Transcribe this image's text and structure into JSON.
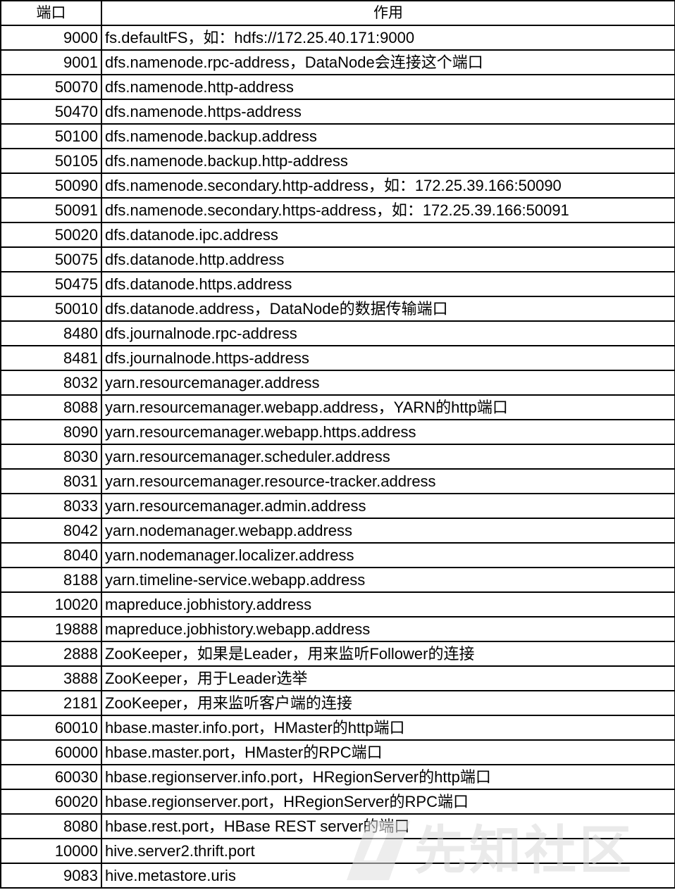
{
  "headers": {
    "port": "端口",
    "use": "作用"
  },
  "rows": [
    {
      "port": "9000",
      "use": "fs.defaultFS，如：hdfs://172.25.40.171:9000"
    },
    {
      "port": "9001",
      "use": "dfs.namenode.rpc-address，DataNode会连接这个端口"
    },
    {
      "port": "50070",
      "use": "dfs.namenode.http-address"
    },
    {
      "port": "50470",
      "use": "dfs.namenode.https-address"
    },
    {
      "port": "50100",
      "use": "dfs.namenode.backup.address"
    },
    {
      "port": "50105",
      "use": "dfs.namenode.backup.http-address"
    },
    {
      "port": "50090",
      "use": "dfs.namenode.secondary.http-address，如：172.25.39.166:50090"
    },
    {
      "port": "50091",
      "use": "dfs.namenode.secondary.https-address，如：172.25.39.166:50091"
    },
    {
      "port": "50020",
      "use": "dfs.datanode.ipc.address"
    },
    {
      "port": "50075",
      "use": "dfs.datanode.http.address"
    },
    {
      "port": "50475",
      "use": "dfs.datanode.https.address"
    },
    {
      "port": "50010",
      "use": "dfs.datanode.address，DataNode的数据传输端口"
    },
    {
      "port": "8480",
      "use": "dfs.journalnode.rpc-address"
    },
    {
      "port": "8481",
      "use": "dfs.journalnode.https-address"
    },
    {
      "port": "8032",
      "use": "yarn.resourcemanager.address"
    },
    {
      "port": "8088",
      "use": "yarn.resourcemanager.webapp.address，YARN的http端口"
    },
    {
      "port": "8090",
      "use": "yarn.resourcemanager.webapp.https.address"
    },
    {
      "port": "8030",
      "use": "yarn.resourcemanager.scheduler.address"
    },
    {
      "port": "8031",
      "use": "yarn.resourcemanager.resource-tracker.address"
    },
    {
      "port": "8033",
      "use": "yarn.resourcemanager.admin.address"
    },
    {
      "port": "8042",
      "use": "yarn.nodemanager.webapp.address"
    },
    {
      "port": "8040",
      "use": "yarn.nodemanager.localizer.address"
    },
    {
      "port": "8188",
      "use": "yarn.timeline-service.webapp.address"
    },
    {
      "port": "10020",
      "use": "mapreduce.jobhistory.address"
    },
    {
      "port": "19888",
      "use": "mapreduce.jobhistory.webapp.address"
    },
    {
      "port": "2888",
      "use": "ZooKeeper，如果是Leader，用来监听Follower的连接"
    },
    {
      "port": "3888",
      "use": "ZooKeeper，用于Leader选举"
    },
    {
      "port": "2181",
      "use": "ZooKeeper，用来监听客户端的连接"
    },
    {
      "port": "60010",
      "use": "hbase.master.info.port，HMaster的http端口"
    },
    {
      "port": "60000",
      "use": "hbase.master.port，HMaster的RPC端口"
    },
    {
      "port": "60030",
      "use": "hbase.regionserver.info.port，HRegionServer的http端口"
    },
    {
      "port": "60020",
      "use": "hbase.regionserver.port，HRegionServer的RPC端口"
    },
    {
      "port": "8080",
      "use": "hbase.rest.port，HBase REST server的端口"
    },
    {
      "port": "10000",
      "use": "hive.server2.thrift.port"
    },
    {
      "port": "9083",
      "use": "hive.metastore.uris"
    }
  ],
  "watermark": {
    "text": "先知社区",
    "icon": "xianzhi-logo-icon",
    "color": "#d9d9d9"
  }
}
